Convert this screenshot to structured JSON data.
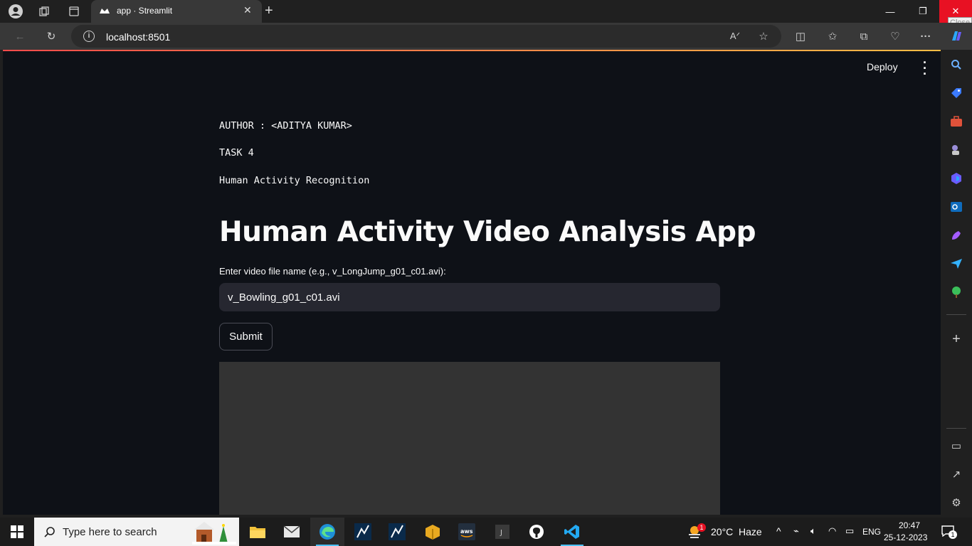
{
  "browser": {
    "tab_title": "app · Streamlit",
    "url": "localhost:8501",
    "close_tooltip": "Close"
  },
  "app": {
    "deploy_label": "Deploy",
    "author_line": "AUTHOR : <ADITYA KUMAR>",
    "task_line": "TASK 4",
    "subtitle_line": "Human Activity Recognition",
    "title": "Human Activity Video Analysis App",
    "input_label": "Enter video file name (e.g., v_LongJump_g01_c01.avi):",
    "input_value": "v_Bowling_g01_c01.avi",
    "submit_label": "Submit"
  },
  "taskbar": {
    "search_placeholder": "Type here to search",
    "weather_temp": "20°C",
    "weather_desc": "Haze",
    "weather_badge": "1",
    "language": "ENG",
    "time": "20:47",
    "date": "25-12-2023",
    "notification_count": "1"
  },
  "colors": {
    "app_bg": "#0e1117",
    "input_bg": "#262730",
    "video_bg": "#333333",
    "accent_gradient_start": "#ff4b4b",
    "accent_gradient_end": "#ffbd45",
    "close_red": "#e81123"
  }
}
